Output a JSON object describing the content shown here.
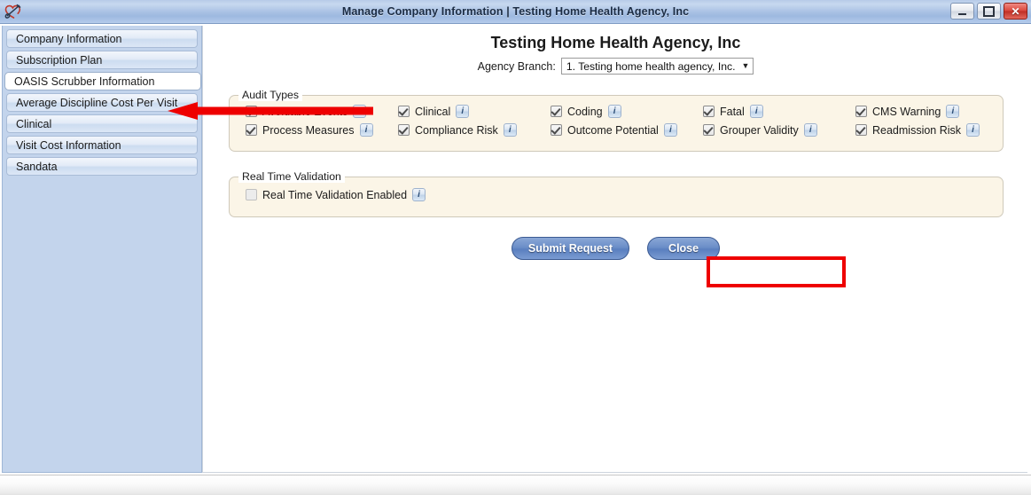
{
  "window": {
    "title": "Manage Company Information | Testing Home Health Agency, Inc",
    "app_icon": "heart-stethoscope-icon",
    "controls": {
      "minimize": "minimize-icon",
      "maximize": "maximize-icon",
      "close": "✕"
    }
  },
  "sidebar": {
    "items": [
      {
        "label": "Company Information",
        "selected": false
      },
      {
        "label": "Subscription Plan",
        "selected": false
      },
      {
        "label": "OASIS Scrubber Information",
        "selected": true
      },
      {
        "label": "Average Discipline Cost Per Visit",
        "selected": false
      },
      {
        "label": "Clinical",
        "selected": false
      },
      {
        "label": "Visit Cost Information",
        "selected": false
      },
      {
        "label": "Sandata",
        "selected": false
      }
    ]
  },
  "main": {
    "page_title": "Testing Home Health Agency, Inc",
    "branch_label": "Agency Branch:",
    "branch_value": "1. Testing home health agency, Inc.",
    "branch_caret": "▼",
    "audit_types": {
      "legend": "Audit Types",
      "items": [
        {
          "label": "Avoidable Events",
          "checked": true,
          "info": "i"
        },
        {
          "label": "Clinical",
          "checked": true,
          "info": "i"
        },
        {
          "label": "Coding",
          "checked": true,
          "info": "i"
        },
        {
          "label": "Fatal",
          "checked": true,
          "info": "i"
        },
        {
          "label": "CMS Warning",
          "checked": true,
          "info": "i"
        },
        {
          "label": "Process Measures",
          "checked": true,
          "info": "i"
        },
        {
          "label": "Compliance Risk",
          "checked": true,
          "info": "i"
        },
        {
          "label": "Outcome Potential",
          "checked": true,
          "info": "i"
        },
        {
          "label": "Grouper Validity",
          "checked": true,
          "info": "i"
        },
        {
          "label": "Readmission Risk",
          "checked": true,
          "info": "i"
        }
      ]
    },
    "real_time_validation": {
      "legend": "Real Time Validation",
      "label": "Real Time Validation Enabled",
      "checked": false,
      "info": "i"
    },
    "buttons": {
      "submit": "Submit Request",
      "close": "Close"
    }
  },
  "annotations": {
    "arrow_color": "#ee0000",
    "highlight_color": "#ee0000",
    "arrow_target": "OASIS Scrubber Information",
    "highlight_target": "Submit Request"
  },
  "colors": {
    "titlebar_blue": "#a9c1e4",
    "sidebar_blue": "#c3d4ec",
    "fieldset_cream": "#fbf5e7",
    "button_blue": "#6b8ec8",
    "accent_red": "#ee0000"
  }
}
